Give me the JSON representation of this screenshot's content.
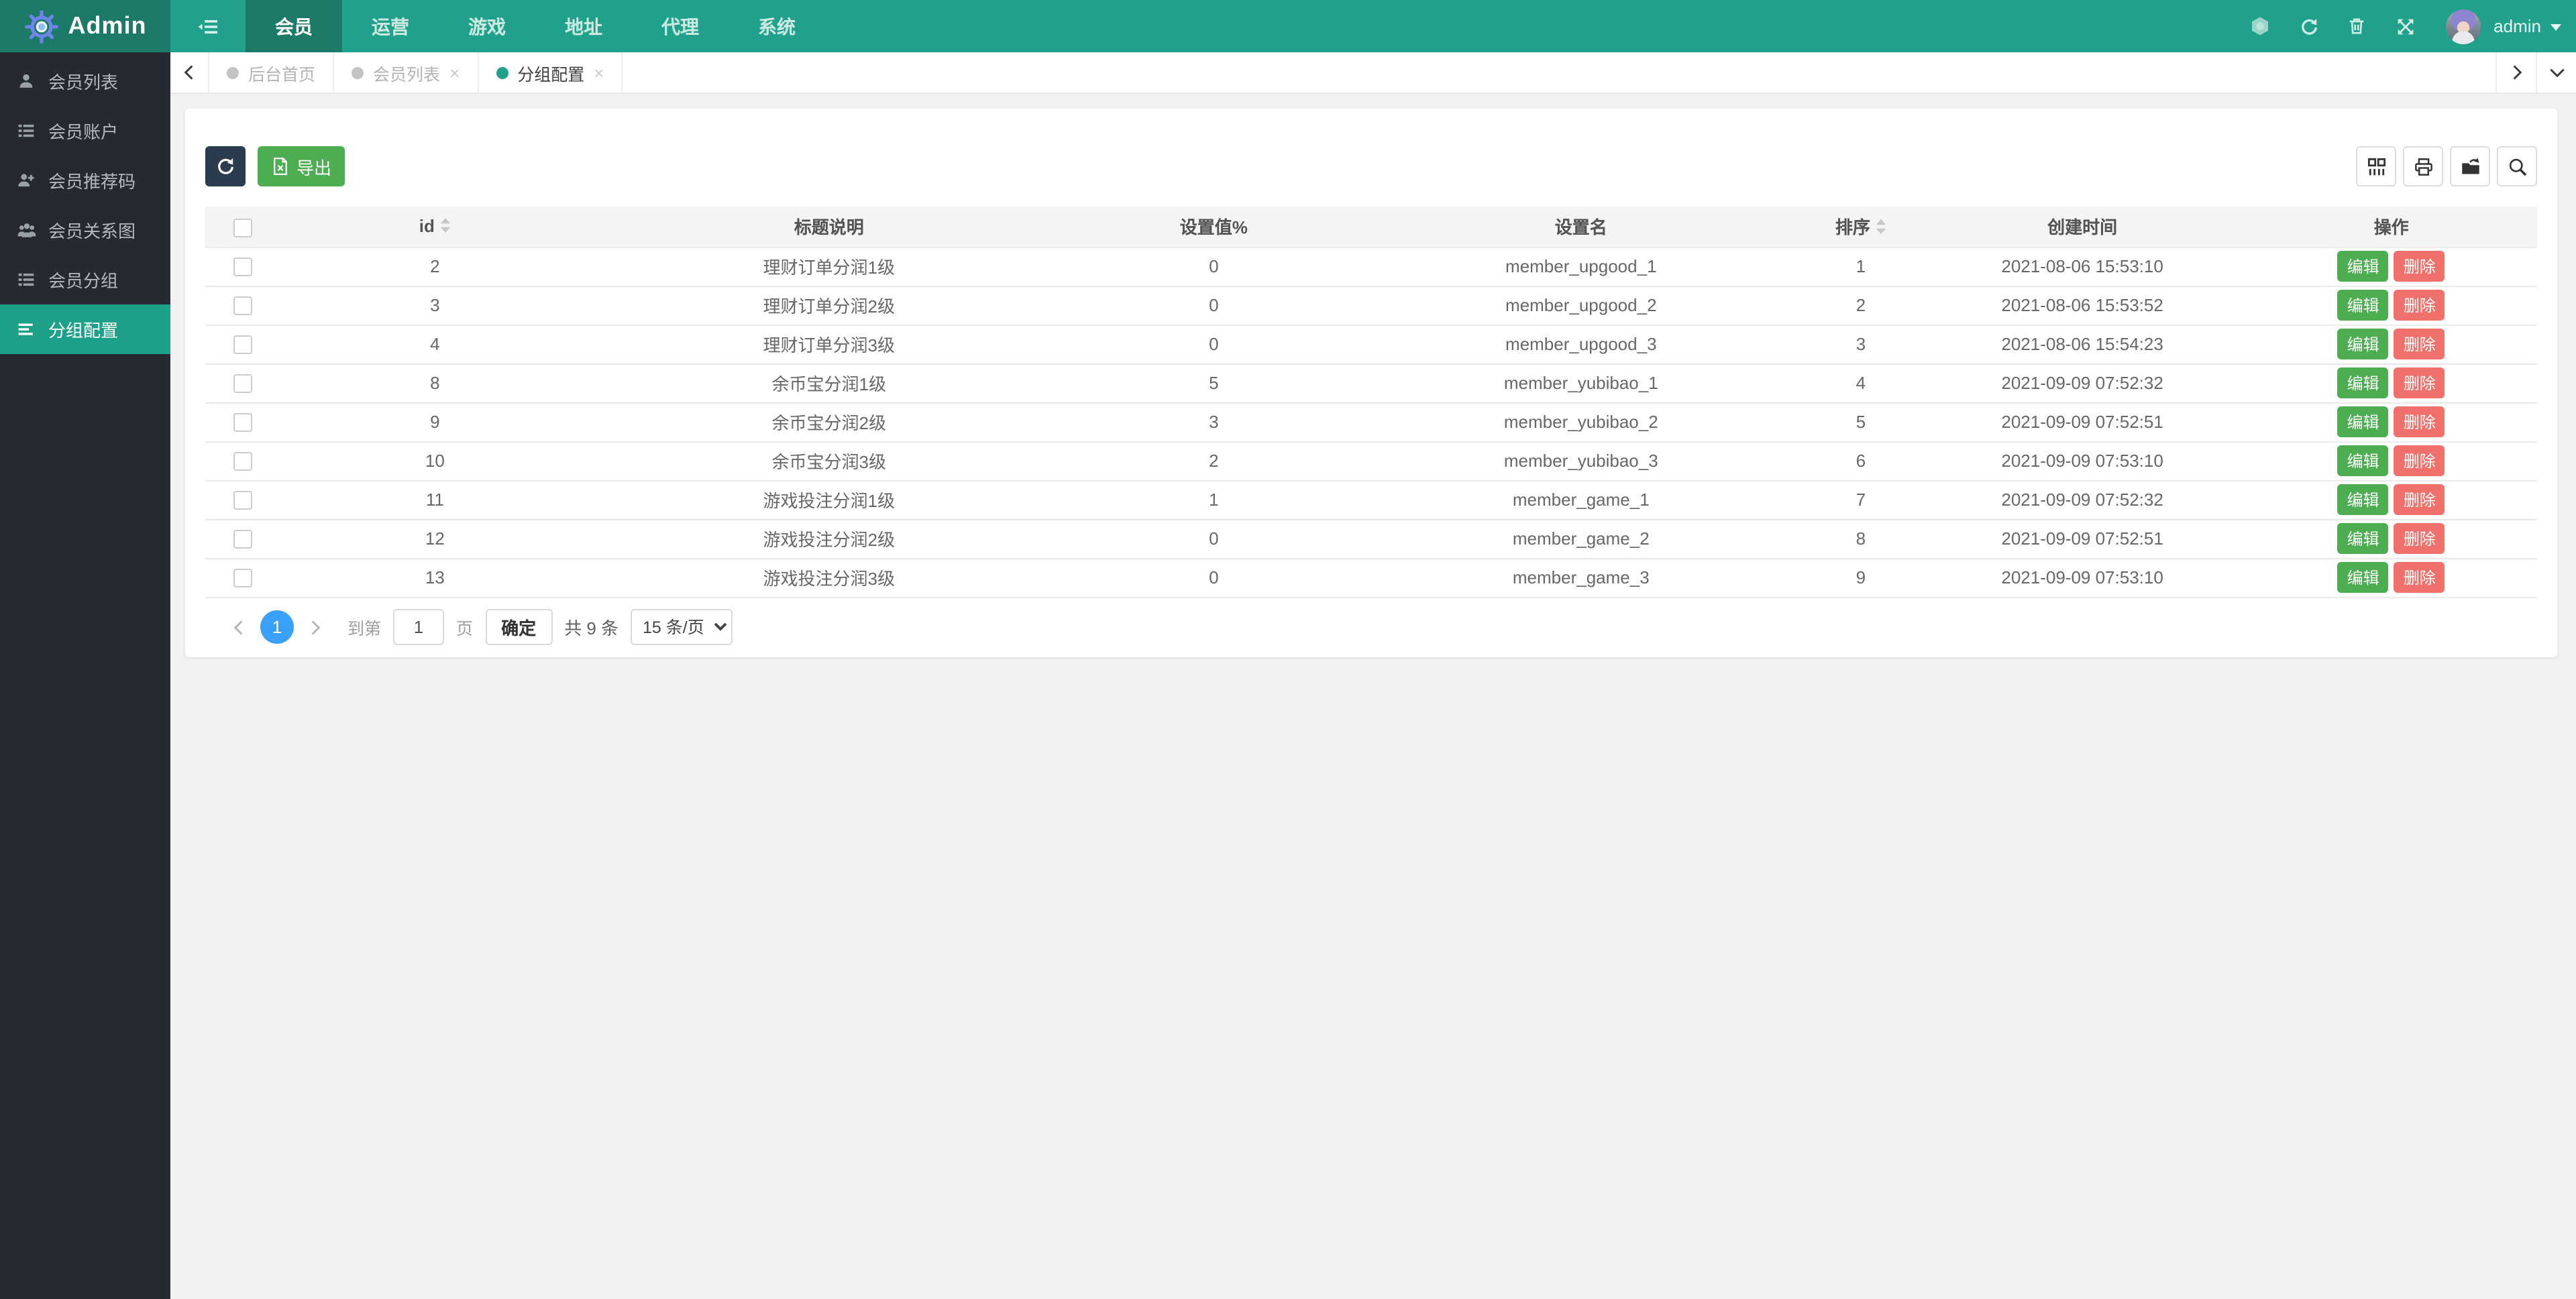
{
  "navbar": {
    "brand": "Admin",
    "menu": [
      {
        "label": "会员",
        "active": true
      },
      {
        "label": "运营",
        "active": false
      },
      {
        "label": "游戏",
        "active": false
      },
      {
        "label": "地址",
        "active": false
      },
      {
        "label": "代理",
        "active": false
      },
      {
        "label": "系统",
        "active": false
      }
    ],
    "right_icons": [
      {
        "name": "hexagon-cache-icon",
        "icon": "hexagon"
      },
      {
        "name": "refresh-icon",
        "icon": "refresh"
      },
      {
        "name": "trash-icon",
        "icon": "trash"
      },
      {
        "name": "fullscreen-icon",
        "icon": "expand"
      }
    ],
    "user": {
      "name": "admin"
    }
  },
  "sidebar": {
    "items": [
      {
        "label": "会员列表",
        "icon": "user",
        "active": false
      },
      {
        "label": "会员账户",
        "icon": "list",
        "active": false
      },
      {
        "label": "会员推荐码",
        "icon": "user-plus",
        "active": false
      },
      {
        "label": "会员关系图",
        "icon": "users",
        "active": false
      },
      {
        "label": "会员分组",
        "icon": "list",
        "active": false
      },
      {
        "label": "分组配置",
        "icon": "bars",
        "active": true
      }
    ]
  },
  "tabbar": {
    "tabs": [
      {
        "label": "后台首页",
        "closable": false,
        "active": false
      },
      {
        "label": "会员列表",
        "closable": true,
        "active": false
      },
      {
        "label": "分组配置",
        "closable": true,
        "active": true
      }
    ]
  },
  "toolbar": {
    "export_label": "导出"
  },
  "table": {
    "columns": [
      {
        "label": "id",
        "sortable": true
      },
      {
        "label": "标题说明",
        "sortable": false
      },
      {
        "label": "设置值%",
        "sortable": false
      },
      {
        "label": "设置名",
        "sortable": false
      },
      {
        "label": "排序",
        "sortable": true
      },
      {
        "label": "创建时间",
        "sortable": false
      },
      {
        "label": "操作",
        "sortable": false
      }
    ],
    "action_labels": {
      "edit": "编辑",
      "delete": "删除"
    },
    "rows": [
      {
        "id": "2",
        "title": "理财订单分润1级",
        "value": "0",
        "name": "member_upgood_1",
        "sort": "1",
        "created": "2021-08-06 15:53:10"
      },
      {
        "id": "3",
        "title": "理财订单分润2级",
        "value": "0",
        "name": "member_upgood_2",
        "sort": "2",
        "created": "2021-08-06 15:53:52"
      },
      {
        "id": "4",
        "title": "理财订单分润3级",
        "value": "0",
        "name": "member_upgood_3",
        "sort": "3",
        "created": "2021-08-06 15:54:23"
      },
      {
        "id": "8",
        "title": "余币宝分润1级",
        "value": "5",
        "name": "member_yubibao_1",
        "sort": "4",
        "created": "2021-09-09 07:52:32"
      },
      {
        "id": "9",
        "title": "余币宝分润2级",
        "value": "3",
        "name": "member_yubibao_2",
        "sort": "5",
        "created": "2021-09-09 07:52:51"
      },
      {
        "id": "10",
        "title": "余币宝分润3级",
        "value": "2",
        "name": "member_yubibao_3",
        "sort": "6",
        "created": "2021-09-09 07:53:10"
      },
      {
        "id": "11",
        "title": "游戏投注分润1级",
        "value": "1",
        "name": "member_game_1",
        "sort": "7",
        "created": "2021-09-09 07:52:32"
      },
      {
        "id": "12",
        "title": "游戏投注分润2级",
        "value": "0",
        "name": "member_game_2",
        "sort": "8",
        "created": "2021-09-09 07:52:51"
      },
      {
        "id": "13",
        "title": "游戏投注分润3级",
        "value": "0",
        "name": "member_game_3",
        "sort": "9",
        "created": "2021-09-09 07:53:10"
      }
    ]
  },
  "pagination": {
    "current_page": "1",
    "goto_label": "到第",
    "page_input": "1",
    "page_unit": "页",
    "confirm_label": "确定",
    "total_label": "共 9 条",
    "page_size_selected": "15 条/页"
  },
  "colors": {
    "navbar_teal": "#21a18b",
    "navbar_dark_teal": "#1d7a69",
    "sidebar_dark": "#252a32",
    "active_teal": "#1fa189",
    "success_green": "#4cae51",
    "danger_red": "#f0716c",
    "page_blue": "#3aa1f8",
    "refresh_btn_dark": "#2a3c4e"
  }
}
